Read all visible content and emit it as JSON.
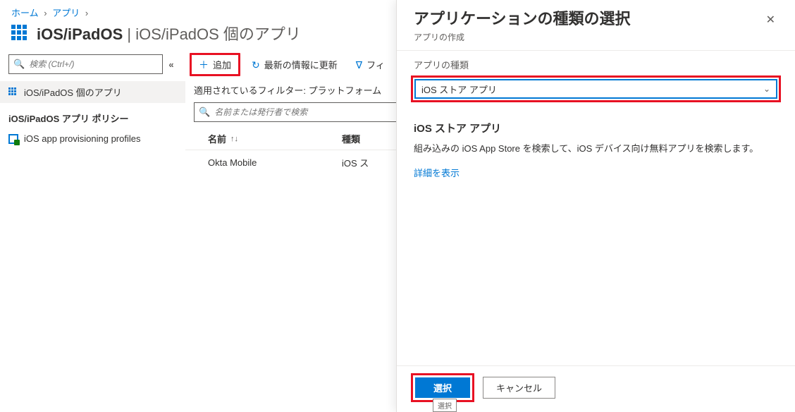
{
  "breadcrumb": {
    "home": "ホーム",
    "apps": "アプリ"
  },
  "page": {
    "title_main": "iOS/iPadOS",
    "title_sep": " | ",
    "title_sub": "iOS/iPadOS 個のアプリ"
  },
  "left": {
    "search_placeholder": "検索 (Ctrl+/)",
    "nav_selected": "iOS/iPadOS 個のアプリ",
    "section_label": "iOS/iPadOS アプリ ポリシー",
    "nav_profiles": "iOS app provisioning profiles"
  },
  "toolbar": {
    "add": "追加",
    "refresh": "最新の情報に更新",
    "filter": "フィ"
  },
  "midlist": {
    "filters_applied": "適用されているフィルター: プラットフォーム",
    "filter_search_placeholder": "名前または発行者で検索",
    "col_name": "名前",
    "col_type": "種類",
    "row1_name": "Okta Mobile",
    "row1_type": "iOS ス"
  },
  "flyout": {
    "title": "アプリケーションの種類の選択",
    "subtitle": "アプリの作成",
    "form_label": "アプリの種類",
    "dropdown_value": "iOS ストア アプリ",
    "section_title": "iOS ストア アプリ",
    "section_desc": "組み込みの iOS App Store を検索して、iOS デバイス向け無料アプリを検索します。",
    "details_link": "詳細を表示",
    "select_btn": "選択",
    "cancel_btn": "キャンセル",
    "tiny_note": "選択"
  }
}
